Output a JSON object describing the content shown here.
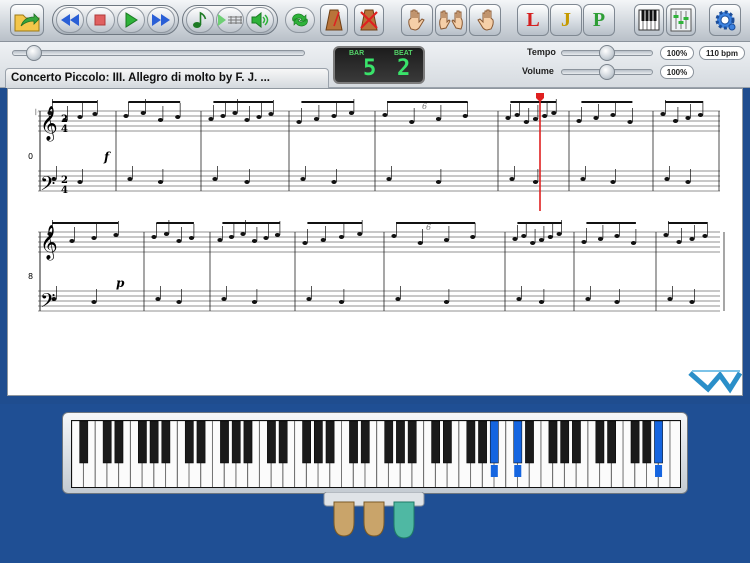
{
  "toolbar": {
    "buttons": [
      {
        "name": "open-file-button",
        "icon": "folder-arrow-icon"
      },
      {
        "name": "rewind-button",
        "icon": "rewind-icon"
      },
      {
        "name": "stop-button",
        "icon": "stop-icon"
      },
      {
        "name": "play-button",
        "icon": "play-icon"
      },
      {
        "name": "fast-forward-button",
        "icon": "fast-forward-icon"
      },
      {
        "name": "note-button",
        "icon": "eighth-note-icon"
      },
      {
        "name": "play-bars-button",
        "icon": "play-bars-icon"
      },
      {
        "name": "volume-button",
        "icon": "speaker-icon"
      },
      {
        "name": "loop-button",
        "icon": "loop-icon"
      },
      {
        "name": "metronome-button",
        "icon": "metronome-icon"
      },
      {
        "name": "metronome-mute-button",
        "icon": "metronome-off-icon"
      },
      {
        "name": "left-hand-button",
        "icon": "left-hand-icon"
      },
      {
        "name": "both-hands-button",
        "icon": "both-hands-icon"
      },
      {
        "name": "right-hand-button",
        "icon": "right-hand-icon"
      },
      {
        "name": "piano-view-button",
        "icon": "piano-keys-icon"
      },
      {
        "name": "mixer-button",
        "icon": "mixer-icon"
      },
      {
        "name": "settings-button",
        "icon": "gear-icon"
      }
    ],
    "letters": {
      "left": "L",
      "both": "J",
      "right": "P"
    },
    "letter_colors": {
      "left": "#d42020",
      "both": "#c59a00",
      "right": "#2e9e36"
    }
  },
  "info": {
    "bar_label": "BAR",
    "beat_label": "BEAT",
    "bar_value": "5",
    "beat_value": "2",
    "tempo_label": "Tempo",
    "tempo_value": "100%",
    "bpm_value": "110 bpm",
    "volume_label": "Volume",
    "volume_value": "100%",
    "progress": 0.04,
    "tempo_slider": 0.5,
    "volume_slider": 0.5
  },
  "score": {
    "title": "Concerto Piccolo: III. Allegro di molto by F. J. ...",
    "time_signature": [
      "2",
      "4"
    ],
    "system1_number": "0",
    "system2_number": "8",
    "dynamic1": "f",
    "dynamic2": "p",
    "tuplet": "6",
    "repeat_sign": "𝄆"
  },
  "keyboard": {
    "white_key_count": 52,
    "pressed_black_keys": [
      25,
      26,
      35
    ],
    "pedal_colors": [
      "#c9a46a",
      "#c9a46a",
      "#4fb8a3"
    ]
  },
  "colors": {
    "accent_blue": "#2a5fd6",
    "play_green": "#2fb33a",
    "stop_red": "#e06060",
    "playhead_red": "#e02020",
    "lcd_green": "#39e36a",
    "key_blue": "#1565e0"
  }
}
